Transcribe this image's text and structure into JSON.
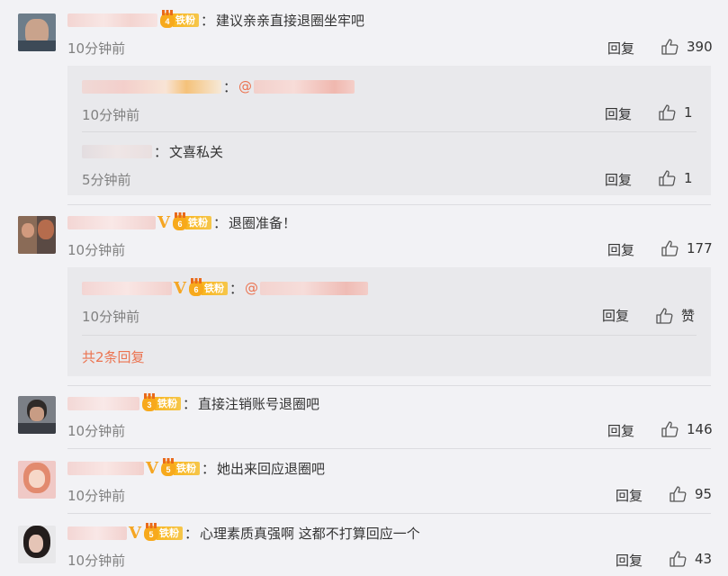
{
  "fan_badge_label": "铁粉",
  "reply_label": "回复",
  "like_placeholder": "赞",
  "colon": "：",
  "comments": [
    {
      "fan_level": "4",
      "text": "建议亲亲直接退圈坐牢吧",
      "time": "10分钟前",
      "likes": "390",
      "replies": [
        {
          "mention": "@",
          "time": "10分钟前",
          "likes": "1"
        },
        {
          "text": "文喜私关",
          "time": "5分钟前",
          "likes": "1"
        }
      ]
    },
    {
      "fan_level": "6",
      "text": "退圈准备！",
      "time": "10分钟前",
      "likes": "177",
      "replies": [
        {
          "fan_level": "6",
          "mention": "@",
          "time": "10分钟前",
          "likes": "赞"
        }
      ],
      "more_replies": "共2条回复"
    },
    {
      "fan_level": "3",
      "text": "直接注销账号退圈吧",
      "time": "10分钟前",
      "likes": "146"
    },
    {
      "fan_level": "5",
      "text": "她出来回应退圈吧",
      "time": "10分钟前",
      "likes": "95"
    },
    {
      "fan_level": "5",
      "text": "心理素质真强啊 这都不打算回应一个",
      "time": "10分钟前",
      "likes": "43"
    }
  ]
}
